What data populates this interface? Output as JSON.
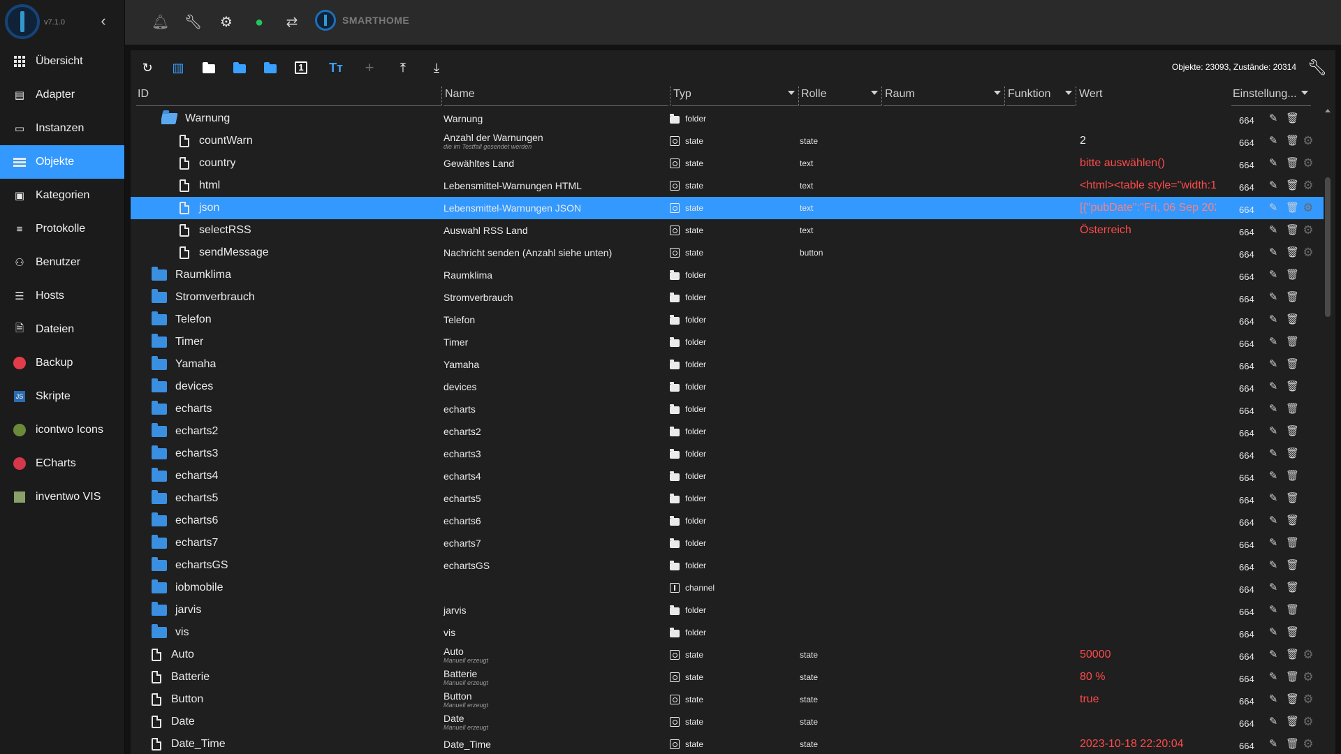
{
  "app": {
    "version": "v7.1.0",
    "brand": "SMARTHOME"
  },
  "sidebar": {
    "items": [
      {
        "label": "Übersicht",
        "icon": "grid-icon"
      },
      {
        "label": "Adapter",
        "icon": "store-icon"
      },
      {
        "label": "Instanzen",
        "icon": "instances-icon"
      },
      {
        "label": "Objekte",
        "icon": "list-icon",
        "active": true
      },
      {
        "label": "Kategorien",
        "icon": "categories-icon"
      },
      {
        "label": "Protokolle",
        "icon": "logs-icon"
      },
      {
        "label": "Benutzer",
        "icon": "user-icon"
      },
      {
        "label": "Hosts",
        "icon": "hosts-icon"
      },
      {
        "label": "Dateien",
        "icon": "files-icon"
      },
      {
        "label": "Backup",
        "icon": "backup-icon"
      },
      {
        "label": "Skripte",
        "icon": "scripts-icon"
      },
      {
        "label": "icontwo Icons",
        "icon": "icontwo-icon"
      },
      {
        "label": "ECharts",
        "icon": "echarts-icon"
      },
      {
        "label": "inventwo VIS",
        "icon": "inventwo-icon"
      }
    ]
  },
  "toolbar": {
    "stats": "Objekte: 23093, Zustände: 20314"
  },
  "columns": {
    "id": "ID",
    "name": "Name",
    "type": "Typ",
    "role": "Rolle",
    "room": "Raum",
    "function": "Funktion",
    "value": "Wert",
    "settings": "Einstellung..."
  },
  "colors": {
    "accent": "#3399ff",
    "value_red": "#ff4a4a",
    "folder_blue": "#3a8fe0"
  },
  "rows": [
    {
      "id": "Warnung",
      "kind": "folder-open",
      "indent": 1,
      "name": "Warnung",
      "type": "folder",
      "role": "",
      "value": "",
      "num": "664"
    },
    {
      "id": "countWarn",
      "kind": "file",
      "indent": 2,
      "name": "Anzahl der Warnungen",
      "sub": "die im Testfall gesendet werden",
      "type": "state",
      "role": "state",
      "value": "2",
      "valueStyle": "white",
      "num": "664",
      "gear": true
    },
    {
      "id": "country",
      "kind": "file",
      "indent": 2,
      "name": "Gewähltes Land",
      "type": "state",
      "role": "text",
      "value": "bitte auswählen()",
      "num": "664",
      "gear": true
    },
    {
      "id": "html",
      "kind": "file",
      "indent": 2,
      "name": "Lebensmittel-Warnungen HTML",
      "type": "state",
      "role": "text",
      "value": "<html><table style=\"width:1...",
      "num": "664",
      "gear": true
    },
    {
      "id": "json",
      "kind": "file",
      "indent": 2,
      "name": "Lebensmittel-Warnungen JSON",
      "type": "state",
      "role": "text",
      "value": "[{\"pubDate\":\"Fri, 06 Sep 2024...",
      "num": "664",
      "gear": true,
      "selected": true
    },
    {
      "id": "selectRSS",
      "kind": "file",
      "indent": 2,
      "name": "Auswahl RSS Land",
      "type": "state",
      "role": "text",
      "value": "Österreich",
      "num": "664",
      "gear": true
    },
    {
      "id": "sendMessage",
      "kind": "file",
      "indent": 2,
      "name": "Nachricht senden (Anzahl siehe unten)",
      "type": "state",
      "role": "button",
      "value": "",
      "num": "664",
      "gear": true
    },
    {
      "id": "Raumklima",
      "kind": "folder",
      "indent": 0,
      "name": "Raumklima",
      "type": "folder",
      "role": "",
      "value": "",
      "num": "664"
    },
    {
      "id": "Stromverbrauch",
      "kind": "folder",
      "indent": 0,
      "name": "Stromverbrauch",
      "type": "folder",
      "role": "",
      "value": "",
      "num": "664"
    },
    {
      "id": "Telefon",
      "kind": "folder",
      "indent": 0,
      "name": "Telefon",
      "type": "folder",
      "role": "",
      "value": "",
      "num": "664"
    },
    {
      "id": "Timer",
      "kind": "folder",
      "indent": 0,
      "name": "Timer",
      "type": "folder",
      "role": "",
      "value": "",
      "num": "664"
    },
    {
      "id": "Yamaha",
      "kind": "folder",
      "indent": 0,
      "name": "Yamaha",
      "type": "folder",
      "role": "",
      "value": "",
      "num": "664"
    },
    {
      "id": "devices",
      "kind": "folder",
      "indent": 0,
      "name": "devices",
      "type": "folder",
      "role": "",
      "value": "",
      "num": "664"
    },
    {
      "id": "echarts",
      "kind": "folder",
      "indent": 0,
      "name": "echarts",
      "type": "folder",
      "role": "",
      "value": "",
      "num": "664"
    },
    {
      "id": "echarts2",
      "kind": "folder",
      "indent": 0,
      "name": "echarts2",
      "type": "folder",
      "role": "",
      "value": "",
      "num": "664"
    },
    {
      "id": "echarts3",
      "kind": "folder",
      "indent": 0,
      "name": "echarts3",
      "type": "folder",
      "role": "",
      "value": "",
      "num": "664"
    },
    {
      "id": "echarts4",
      "kind": "folder",
      "indent": 0,
      "name": "echarts4",
      "type": "folder",
      "role": "",
      "value": "",
      "num": "664"
    },
    {
      "id": "echarts5",
      "kind": "folder",
      "indent": 0,
      "name": "echarts5",
      "type": "folder",
      "role": "",
      "value": "",
      "num": "664"
    },
    {
      "id": "echarts6",
      "kind": "folder",
      "indent": 0,
      "name": "echarts6",
      "type": "folder",
      "role": "",
      "value": "",
      "num": "664"
    },
    {
      "id": "echarts7",
      "kind": "folder",
      "indent": 0,
      "name": "echarts7",
      "type": "folder",
      "role": "",
      "value": "",
      "num": "664"
    },
    {
      "id": "echartsGS",
      "kind": "folder",
      "indent": 0,
      "name": "echartsGS",
      "type": "folder",
      "role": "",
      "value": "",
      "num": "664"
    },
    {
      "id": "iobmobile",
      "kind": "folder",
      "indent": 0,
      "name": "",
      "type": "channel",
      "role": "",
      "value": "",
      "num": "664"
    },
    {
      "id": "jarvis",
      "kind": "folder",
      "indent": 0,
      "name": "jarvis",
      "type": "folder",
      "role": "",
      "value": "",
      "num": "664"
    },
    {
      "id": "vis",
      "kind": "folder",
      "indent": 0,
      "name": "vis",
      "type": "folder",
      "role": "",
      "value": "",
      "num": "664"
    },
    {
      "id": "Auto",
      "kind": "file",
      "indent": 0,
      "name": "Auto",
      "sub": "Manuell erzeugt",
      "type": "state",
      "role": "state",
      "value": "50000",
      "num": "664",
      "gear": true
    },
    {
      "id": "Batterie",
      "kind": "file",
      "indent": 0,
      "name": "Batterie",
      "sub": "Manuell erzeugt",
      "type": "state",
      "role": "state",
      "value": "80 %",
      "num": "664",
      "gear": true
    },
    {
      "id": "Button",
      "kind": "file",
      "indent": 0,
      "name": "Button",
      "sub": "Manuell erzeugt",
      "type": "state",
      "role": "state",
      "value": "true",
      "num": "664",
      "gear": true
    },
    {
      "id": "Date",
      "kind": "file",
      "indent": 0,
      "name": "Date",
      "sub": "Manuell erzeugt",
      "type": "state",
      "role": "state",
      "value": "",
      "num": "664",
      "gear": true
    },
    {
      "id": "Date_Time",
      "kind": "file",
      "indent": 0,
      "name": "Date_Time",
      "type": "state",
      "role": "state",
      "value": "2023-10-18 22:20:04",
      "num": "664",
      "gear": true
    }
  ]
}
